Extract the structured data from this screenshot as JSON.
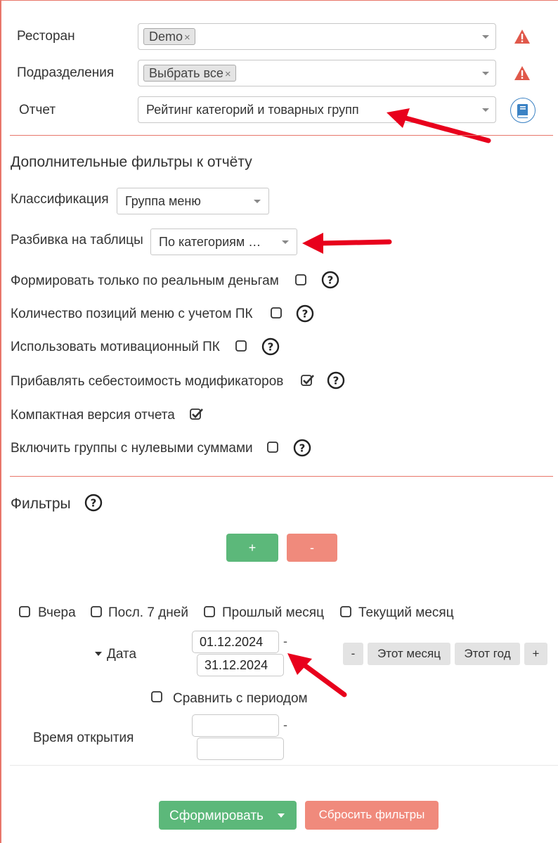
{
  "top": {
    "restaurant": {
      "label": "Ресторан",
      "tag": "Demo",
      "tag_remove": "×"
    },
    "departments": {
      "label": "Подразделения",
      "tag": "Выбрать все",
      "tag_remove": "×"
    },
    "report": {
      "label": "Отчет",
      "value": "Рейтинг категорий и товарных групп"
    }
  },
  "extra_filters": {
    "title": "Дополнительные фильтры к отчёту",
    "classification": {
      "label": "Классификация",
      "value": "Группа меню"
    },
    "table_split": {
      "label": "Разбивка на таблицы",
      "value": "По категориям …"
    },
    "options": [
      {
        "label": "Формировать только по реальным деньгам",
        "checked": false,
        "help": true
      },
      {
        "label": "Количество позиций меню с учетом ПК",
        "checked": false,
        "help": true
      },
      {
        "label": "Использовать мотивационный ПК",
        "checked": false,
        "help": true
      },
      {
        "label": "Прибавлять себестоимость модификаторов",
        "checked": true,
        "help": true
      },
      {
        "label": "Компактная версия отчета",
        "checked": true,
        "help": false
      },
      {
        "label": "Включить группы с нулевыми суммами",
        "checked": false,
        "help": true
      }
    ]
  },
  "filters": {
    "title": "Фильтры",
    "add_label": "+",
    "remove_label": "-",
    "quick_periods": [
      {
        "label": "Вчера",
        "checked": false
      },
      {
        "label": "Посл. 7 дней",
        "checked": false
      },
      {
        "label": "Прошлый месяц",
        "checked": false
      },
      {
        "label": "Текущий месяц",
        "checked": false
      }
    ],
    "date": {
      "label": "Дата",
      "from": "01.12.2024",
      "separator": "-",
      "to": "31.12.2024",
      "minus": "-",
      "this_month": "Этот месяц",
      "this_year": "Этот год",
      "plus": "+"
    },
    "compare": {
      "label": "Сравнить с периодом",
      "checked": false
    },
    "open_time": {
      "label": "Время открытия",
      "from": "",
      "to": "",
      "separator": "-"
    }
  },
  "actions": {
    "submit": "Сформировать",
    "reset": "Сбросить фильтры"
  },
  "colors": {
    "green": "#5cb87a",
    "red": "#f08a7c",
    "warn": "#e0584a",
    "arrow": "#e8001c",
    "book": "#3b82c4"
  }
}
